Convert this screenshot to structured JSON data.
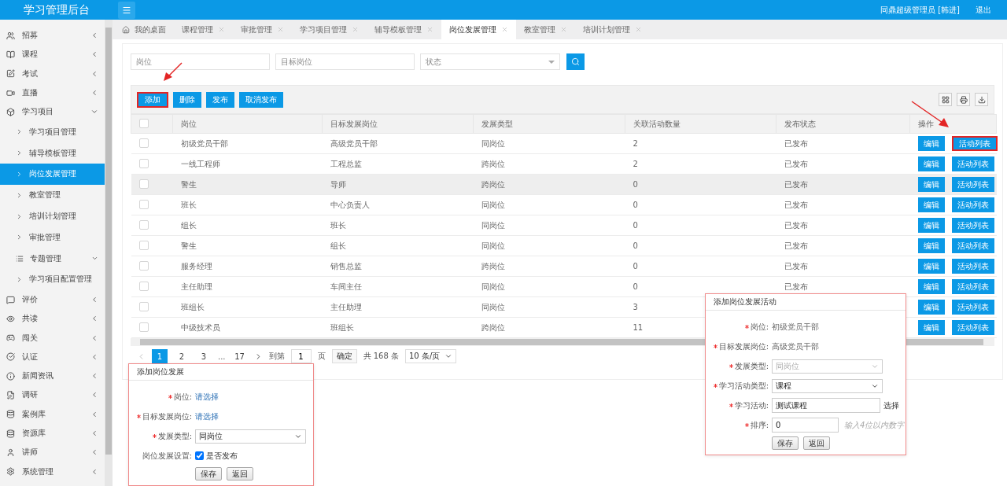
{
  "header": {
    "title": "学习管理后台",
    "user": "同鼎超级管理员 [韩进]",
    "logout": "退出"
  },
  "sidebar": {
    "items": [
      {
        "label": "招募",
        "expanded": false
      },
      {
        "label": "课程",
        "expanded": false
      },
      {
        "label": "考试",
        "expanded": false
      },
      {
        "label": "直播",
        "expanded": false
      },
      {
        "label": "学习项目",
        "expanded": true,
        "children": [
          {
            "label": "学习项目管理",
            "kind": "link",
            "selected": false
          },
          {
            "label": "辅导模板管理",
            "kind": "link",
            "selected": false
          },
          {
            "label": "岗位发展管理",
            "kind": "link",
            "selected": true
          },
          {
            "label": "教室管理",
            "kind": "link",
            "selected": false
          },
          {
            "label": "培训计划管理",
            "kind": "link",
            "selected": false
          },
          {
            "label": "审批管理",
            "kind": "link",
            "selected": false
          },
          {
            "label": "专题管理",
            "kind": "group",
            "selected": false
          },
          {
            "label": "学习项目配置管理",
            "kind": "link",
            "selected": false
          }
        ]
      },
      {
        "label": "评价",
        "expanded": false
      },
      {
        "label": "共读",
        "expanded": false
      },
      {
        "label": "闯关",
        "expanded": false
      },
      {
        "label": "认证",
        "expanded": false
      },
      {
        "label": "新闻资讯",
        "expanded": false
      },
      {
        "label": "调研",
        "expanded": false
      },
      {
        "label": "案例库",
        "expanded": false
      },
      {
        "label": "资源库",
        "expanded": false
      },
      {
        "label": "讲师",
        "expanded": false
      },
      {
        "label": "系统管理",
        "expanded": false
      }
    ]
  },
  "tabs": [
    {
      "label": "我的桌面",
      "kind": "home",
      "selected": false
    },
    {
      "label": "课程管理",
      "kind": "closable",
      "selected": false
    },
    {
      "label": "审批管理",
      "kind": "closable",
      "selected": false
    },
    {
      "label": "学习项目管理",
      "kind": "closable",
      "selected": false
    },
    {
      "label": "辅导模板管理",
      "kind": "closable",
      "selected": false
    },
    {
      "label": "岗位发展管理",
      "kind": "closable",
      "selected": true
    },
    {
      "label": "教室管理",
      "kind": "closable",
      "selected": false
    },
    {
      "label": "培训计划管理",
      "kind": "closable",
      "selected": false
    }
  ],
  "filters": {
    "position": {
      "placeholder": "岗位"
    },
    "target": {
      "placeholder": "目标岗位"
    },
    "status": {
      "placeholder": "状态"
    }
  },
  "toolbar": {
    "buttons": [
      {
        "label": "添加",
        "marked": true
      },
      {
        "label": "删除",
        "marked": false
      },
      {
        "label": "发布",
        "marked": false
      },
      {
        "label": "取消发布",
        "marked": false
      }
    ]
  },
  "table": {
    "all_checked": false,
    "columns": [
      "岗位",
      "目标发展岗位",
      "发展类型",
      "关联活动数量",
      "发布状态",
      "操作"
    ],
    "rows": [
      {
        "cells": [
          "初级党员干部",
          "高级党员干部",
          "同岗位",
          "2",
          "已发布"
        ],
        "checked": false,
        "hovered": false,
        "edit": "编辑",
        "activities": "活动列表",
        "marked": true
      },
      {
        "cells": [
          "一线工程师",
          "工程总监",
          "跨岗位",
          "2",
          "已发布"
        ],
        "checked": false,
        "hovered": false,
        "edit": "编辑",
        "activities": "活动列表",
        "marked": false
      },
      {
        "cells": [
          "警生",
          "导师",
          "跨岗位",
          "0",
          "已发布"
        ],
        "checked": false,
        "hovered": true,
        "edit": "编辑",
        "activities": "活动列表",
        "marked": false
      },
      {
        "cells": [
          "班长",
          "中心负责人",
          "同岗位",
          "0",
          "已发布"
        ],
        "checked": false,
        "hovered": false,
        "edit": "编辑",
        "activities": "活动列表",
        "marked": false
      },
      {
        "cells": [
          "组长",
          "班长",
          "同岗位",
          "0",
          "已发布"
        ],
        "checked": false,
        "hovered": false,
        "edit": "编辑",
        "activities": "活动列表",
        "marked": false
      },
      {
        "cells": [
          "警生",
          "组长",
          "同岗位",
          "0",
          "已发布"
        ],
        "checked": false,
        "hovered": false,
        "edit": "编辑",
        "activities": "活动列表",
        "marked": false
      },
      {
        "cells": [
          "服务经理",
          "销售总监",
          "跨岗位",
          "0",
          "已发布"
        ],
        "checked": false,
        "hovered": false,
        "edit": "编辑",
        "activities": "活动列表",
        "marked": false
      },
      {
        "cells": [
          "主任助理",
          "车间主任",
          "同岗位",
          "0",
          "已发布"
        ],
        "checked": false,
        "hovered": false,
        "edit": "编辑",
        "activities": "活动列表",
        "marked": false
      },
      {
        "cells": [
          "班组长",
          "主任助理",
          "同岗位",
          "3"
        ],
        "checked": false,
        "hovered": false,
        "edit": "编辑",
        "activities": "活动列表",
        "marked": false
      },
      {
        "cells": [
          "中级技术员",
          "班组长",
          "跨岗位",
          "11"
        ],
        "checked": false,
        "hovered": false,
        "edit": "编辑",
        "activities": "活动列表",
        "marked": false
      }
    ]
  },
  "pagination": {
    "pages": [
      {
        "label": "1",
        "selected": true
      },
      {
        "label": "2",
        "selected": false
      },
      {
        "label": "3",
        "selected": false
      }
    ],
    "ellipsis": "...",
    "last": "17",
    "goto_label": "到第",
    "goto_value": "1",
    "page_unit": "页",
    "confirm": "确定",
    "total": "共 168 条",
    "page_size": "10 条/页"
  },
  "dialogs": [
    {
      "title": "添加岗位发展",
      "fields": [
        {
          "label": "岗位:",
          "kind": "link",
          "required": true,
          "value": "请选择"
        },
        {
          "label": "目标发展岗位:",
          "kind": "link",
          "required": true,
          "value": "请选择"
        },
        {
          "label": "发展类型:",
          "kind": "select",
          "required": true,
          "value": "同岗位",
          "disabled": false
        },
        {
          "label": "岗位发展设置:",
          "kind": "checkbox",
          "required": false,
          "value": "是否发布",
          "checked": true
        }
      ],
      "buttons": [
        "保存",
        "返回"
      ]
    },
    {
      "title": "添加岗位发展活动",
      "fields": [
        {
          "label": "岗位:",
          "kind": "text",
          "required": true,
          "value": "初级党员干部"
        },
        {
          "label": "目标发展岗位:",
          "kind": "text",
          "required": true,
          "value": "高级党员干部"
        },
        {
          "label": "发展类型:",
          "kind": "select",
          "required": true,
          "value": "同岗位",
          "disabled": true
        },
        {
          "label": "学习活动类型:",
          "kind": "select",
          "required": true,
          "value": "课程",
          "disabled": false
        },
        {
          "label": "学习活动:",
          "kind": "input",
          "required": true,
          "value": "测试课程",
          "suffix": "选择"
        },
        {
          "label": "排序:",
          "kind": "input",
          "required": true,
          "value": "0",
          "hint": "输入4位以内数字"
        }
      ],
      "buttons": [
        "保存",
        "返回"
      ]
    }
  ]
}
